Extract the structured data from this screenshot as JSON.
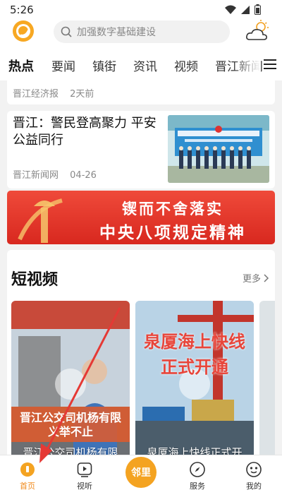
{
  "status_bar": {
    "time": "5:26",
    "icons": [
      "wifi-icon",
      "signal-icon",
      "battery-icon"
    ]
  },
  "header": {
    "logo_icon": "app-logo-icon",
    "search_placeholder": "加强数字基础建设",
    "weather_icon": "cloudy-weather-icon"
  },
  "tabs": [
    {
      "label": "热点",
      "active": true
    },
    {
      "label": "要闻",
      "active": false
    },
    {
      "label": "镇街",
      "active": false
    },
    {
      "label": "资讯",
      "active": false
    },
    {
      "label": "视频",
      "active": false
    },
    {
      "label": "晋江新闻",
      "active": false
    }
  ],
  "feed": {
    "top_item": {
      "source": "晋江经济报",
      "time": "2天前"
    },
    "news_item": {
      "title": "晋江：警民登高聚力 平安公益同行",
      "source": "晋江新闻网",
      "date": "04-26"
    },
    "banner": {
      "line1": "锲而不舍落实",
      "line2": "中央八项规定精神"
    },
    "video_section": {
      "heading": "短视频",
      "more_label": "更多",
      "videos": [
        {
          "overlay": "晋江公交司机杨有限 义举不止",
          "caption": "晋江公交司机杨有限"
        },
        {
          "overlay": "泉厦海上快线 正式开通",
          "caption": "泉厦海上快线正式开"
        }
      ]
    }
  },
  "bottom_nav": [
    {
      "label": "首页",
      "icon": "home-icon",
      "active": true
    },
    {
      "label": "视听",
      "icon": "video-play-icon",
      "active": false
    },
    {
      "label": "邻里",
      "icon": "neighborhood-center-icon",
      "active": false
    },
    {
      "label": "服务",
      "icon": "compass-icon",
      "active": false
    },
    {
      "label": "我的",
      "icon": "user-face-icon",
      "active": false
    }
  ],
  "colors": {
    "accent": "#f08a1c",
    "banner_red": "#d8281f",
    "arrow": "#e53935"
  }
}
